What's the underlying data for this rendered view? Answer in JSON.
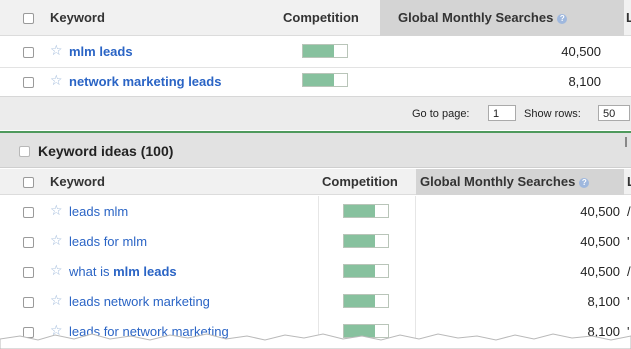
{
  "table1": {
    "headers": {
      "keyword": "Keyword",
      "competition": "Competition",
      "global": "Global Monthly Searches",
      "trunc": "L"
    },
    "rows": [
      {
        "pre": "",
        "bold": "mlm leads",
        "post": "",
        "competition": 0.7,
        "searches": "40,500"
      },
      {
        "pre": "",
        "bold": "network marketing leads",
        "post": "",
        "competition": 0.7,
        "searches": "8,100"
      }
    ]
  },
  "pager": {
    "goto_label": "Go to page:",
    "page_value": "1",
    "rows_label": "Show rows:",
    "rows_value": "50"
  },
  "ideas": {
    "title": "Keyword ideas (100)",
    "headers": {
      "keyword": "Keyword",
      "competition": "Competition",
      "global": "Global Monthly Searches",
      "trunc": "L"
    },
    "rows": [
      {
        "pre": "leads mlm",
        "bold": "",
        "post": "",
        "competition": 0.7,
        "searches": "40,500",
        "trunc": "/"
      },
      {
        "pre": "leads for mlm",
        "bold": "",
        "post": "",
        "competition": 0.7,
        "searches": "40,500",
        "trunc": "'"
      },
      {
        "pre": "what is ",
        "bold": "mlm leads",
        "post": "",
        "competition": 0.7,
        "searches": "40,500",
        "trunc": "/"
      },
      {
        "pre": "leads network marketing",
        "bold": "",
        "post": "",
        "competition": 0.7,
        "searches": "8,100",
        "trunc": "'"
      },
      {
        "pre": "leads for network marketing",
        "bold": "",
        "post": "",
        "competition": 0.7,
        "searches": "8,100",
        "trunc": "'"
      }
    ]
  }
}
